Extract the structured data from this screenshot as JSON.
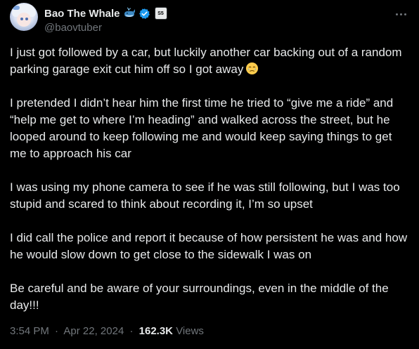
{
  "author": {
    "display_name": "Bao The Whale",
    "handle": "@baovtuber",
    "badge_text": "S5"
  },
  "tweet": {
    "paragraphs": [
      "I just got followed by a car, but luckily another car backing out of a random parking garage exit cut him off so I got away",
      "I pretended I didn’t hear him the first time he tried to “give me a ride” and “help me get to where I’m heading” and walked across the street, but he looped around to keep following me and would keep saying things to get me to approach his car",
      "I was using my phone camera to see if he was still following, but I was too stupid and scared to think about recording it, I’m so upset",
      "I did call the police and report it because of how persistent he was and how he would slow down to get close to the sidewalk I was on",
      "Be careful and be aware of your surroundings, even in the middle of the day!!!"
    ],
    "time": "3:54 PM",
    "date": "Apr 22, 2024",
    "separator": "·",
    "views_count": "162.3K",
    "views_label": "Views"
  },
  "icons": {
    "whale": "whale-emoji",
    "verified": "verified-badge-icon",
    "affiliate": "affiliate-badge",
    "more": "more-options-icon",
    "tear_emoji": "face-holding-back-tears-emoji"
  },
  "colors": {
    "background": "#000000",
    "text": "#e7e9ea",
    "secondary": "#71767b",
    "verified_blue": "#1d9bf0"
  }
}
